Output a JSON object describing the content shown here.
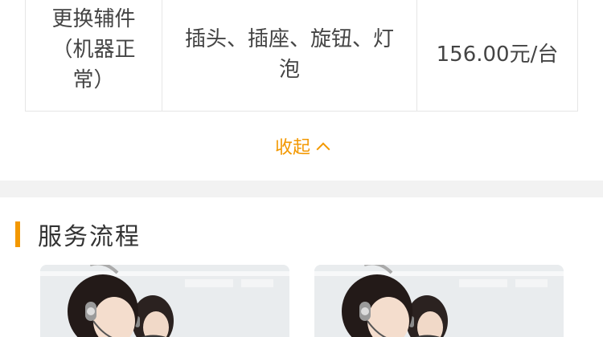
{
  "price_table": {
    "row": {
      "type_lines": [
        "更换辅件",
        "（机器正",
        "常）"
      ],
      "parts_lines": [
        "插头、插座、旋钮、灯",
        "泡"
      ],
      "price": "156.00元/台"
    }
  },
  "collapse": {
    "label": "收起",
    "icon": "chevron-up-icon"
  },
  "service_process": {
    "title": "服务流程",
    "photos": [
      {
        "icon": "customer-service-photo"
      },
      {
        "icon": "customer-service-photo"
      }
    ]
  },
  "colors": {
    "accent": "#f39800",
    "divider": "#f2f2f2",
    "border": "#e6e6e6",
    "text": "#333333"
  }
}
